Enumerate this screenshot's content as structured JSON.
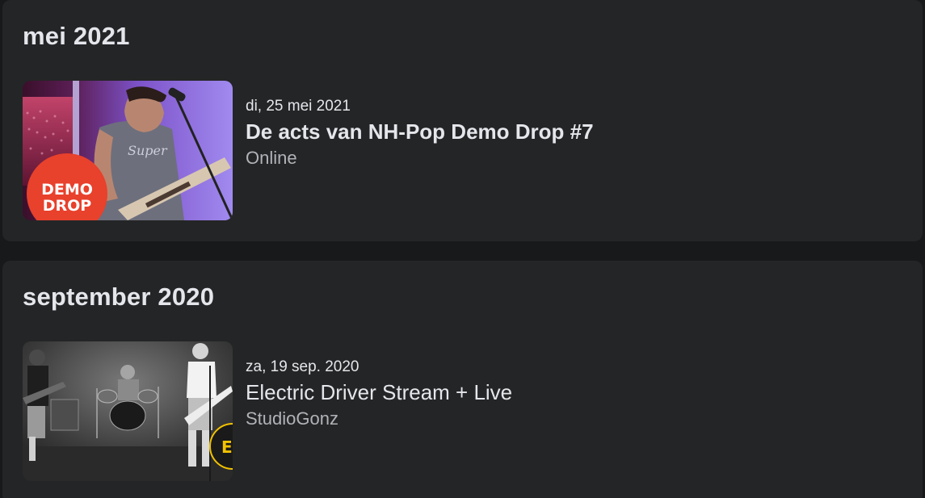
{
  "months": [
    {
      "title": "mei 2021",
      "event": {
        "date": "di, 25 mei 2021",
        "title": "De acts van NH-Pop Demo Drop #7",
        "venue": "Online",
        "thumbnail": {
          "badge_line1": "DEMO",
          "badge_line2": "DROP",
          "badge_color": "#e8412c"
        }
      }
    },
    {
      "title": "september 2020",
      "event": {
        "date": "za, 19 sep. 2020",
        "title": "Electric Driver Stream + Live",
        "venue": "StudioGonz",
        "thumbnail": {
          "badge_text": "EX",
          "badge_color": "#f2c200"
        }
      }
    }
  ],
  "colors": {
    "page_background": "#18191a",
    "card_background": "#242526",
    "primary_text": "#e4e6eb",
    "secondary_text": "#b0b3b8"
  }
}
